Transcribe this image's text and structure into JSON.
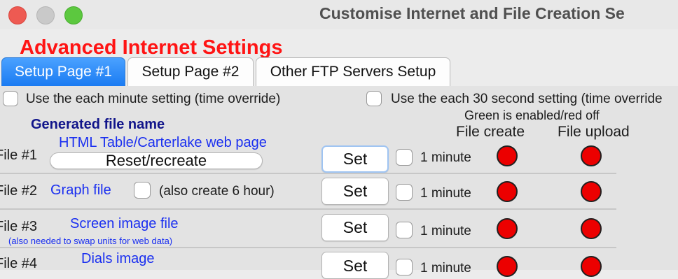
{
  "window": {
    "title": "Customise Internet and File Creation Se"
  },
  "heading": "Advanced Internet Settings",
  "tabs": [
    {
      "label": "Setup Page #1",
      "active": true
    },
    {
      "label": "Setup Page #2",
      "active": false
    },
    {
      "label": "Other FTP Servers Setup",
      "active": false
    }
  ],
  "options": {
    "minute_override": "Use the each minute setting (time override)",
    "thirty_sec_override": "Use the each 30 second setting (time override"
  },
  "columns": {
    "legend": "Green is enabled/red off",
    "file_create": "File create",
    "file_upload": "File upload",
    "generated_file_name": "Generated file name"
  },
  "rows": [
    {
      "label": "File #1",
      "name": "HTML Table/Carterlake web page",
      "reset_label": "Reset/recreate",
      "set_label": "Set",
      "interval": "1 minute"
    },
    {
      "label": "File #2",
      "name": "Graph file",
      "extra": "(also create 6 hour)",
      "set_label": "Set",
      "interval": "1 minute"
    },
    {
      "label": "File #3",
      "name": "Screen image file",
      "note": "(also needed to swap units for web data)",
      "set_label": "Set",
      "interval": "1 minute"
    },
    {
      "label": "File #4",
      "name": "Dials image",
      "set_label": "Set",
      "interval": "1 minute"
    }
  ],
  "colors": {
    "status_off": "#ec0000",
    "heading": "#ff1414",
    "link_blue": "#1a2ff0",
    "tab_active": "#1a7bf2"
  }
}
